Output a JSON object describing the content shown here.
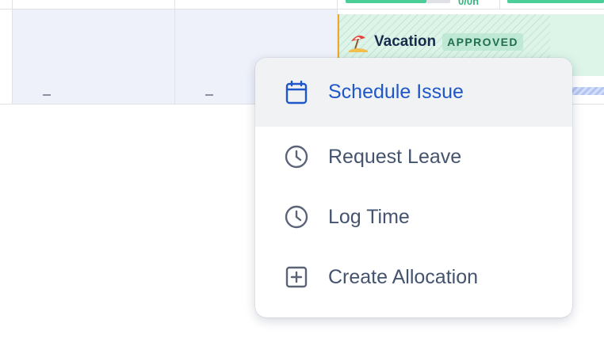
{
  "timeline": {
    "top_progress_text": "0/0h",
    "empty_cells": [
      "–",
      "–"
    ]
  },
  "event": {
    "emoji": "beach-umbrella",
    "title": "Vacation",
    "status": "APPROVED",
    "color": "#dcf5e8"
  },
  "menu": {
    "items": [
      {
        "label": "Schedule Issue",
        "icon": "calendar-icon",
        "active": true
      },
      {
        "label": "Request Leave",
        "icon": "clock-icon",
        "active": false
      },
      {
        "label": "Log Time",
        "icon": "clock-icon",
        "active": false
      },
      {
        "label": "Create Allocation",
        "icon": "plus-square-icon",
        "active": false
      }
    ]
  },
  "colors": {
    "accent": "#1f57c9",
    "success": "#36b37e",
    "menu_text": "#44546f"
  }
}
